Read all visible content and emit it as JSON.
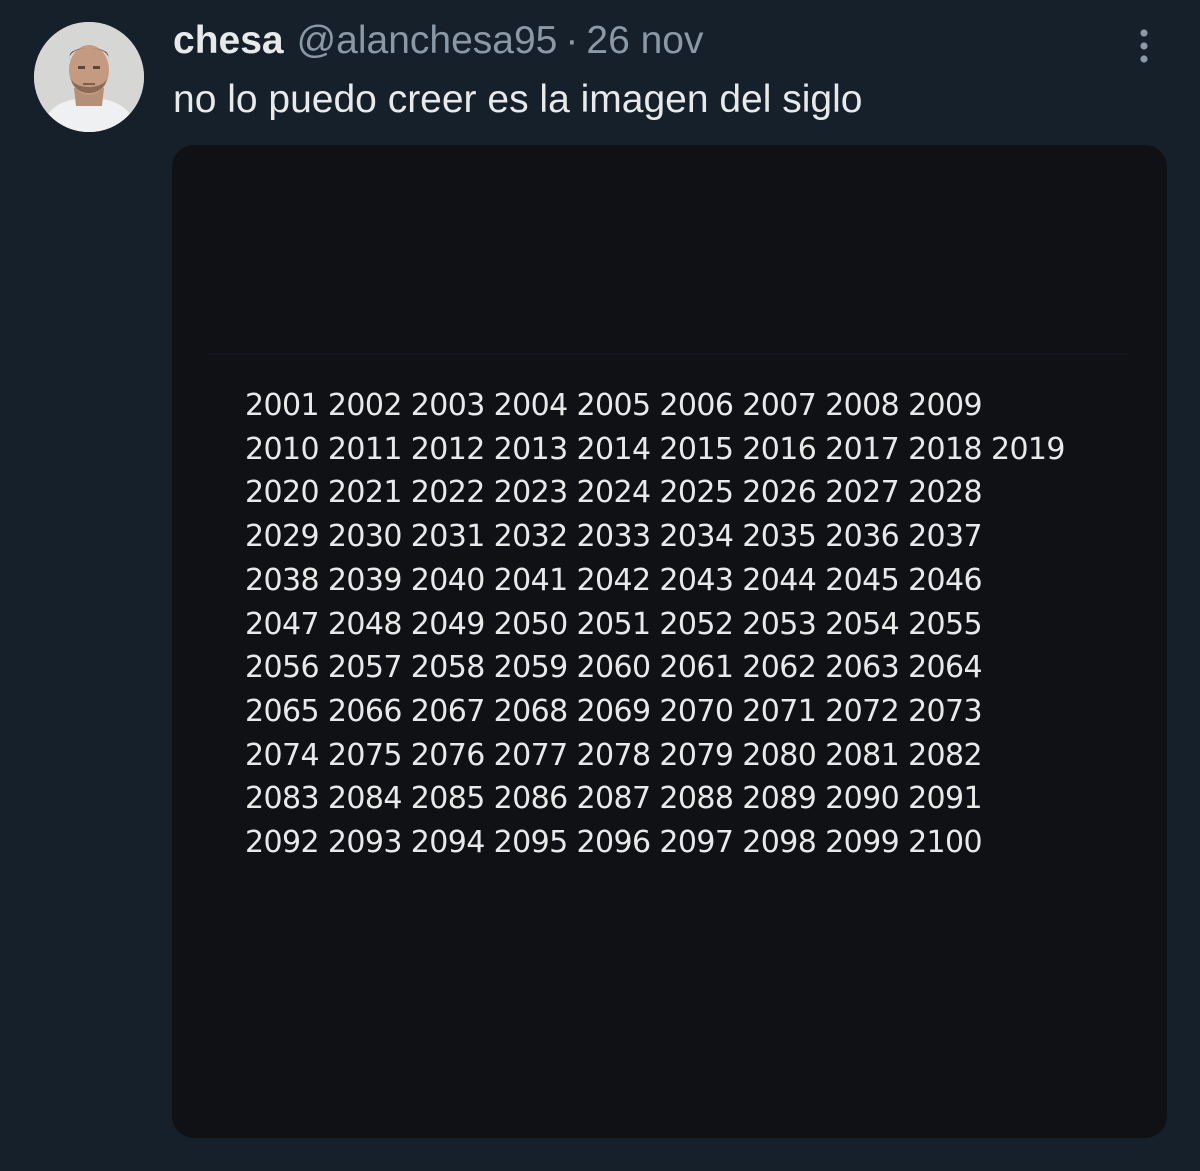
{
  "tweet": {
    "display_name": "chesa",
    "handle": "@alanchesa95",
    "separator": "·",
    "date": "26 nov",
    "text": "no lo puedo creer es la imagen del siglo",
    "more_icon": "vertical-ellipsis-icon",
    "avatar": "profile-photo"
  },
  "media": {
    "rows": [
      "2001 2002 2003 2004 2005 2006 2007 2008 2009",
      "2010 2011 2012 2013 2014 2015 2016 2017 2018 2019",
      "2020 2021 2022 2023 2024 2025 2026 2027 2028",
      "2029 2030 2031 2032 2033 2034 2035 2036 2037",
      "2038 2039 2040 2041 2042 2043 2044 2045 2046",
      "2047 2048 2049 2050 2051 2052 2053 2054 2055",
      "2056 2057 2058 2059 2060 2061 2062 2063 2064",
      "2065 2066 2067 2068 2069 2070 2071 2072 2073",
      "2074 2075 2076 2077 2078 2079 2080 2081 2082",
      "2083 2084 2085 2086 2087 2088 2089 2090 2091",
      "2092 2093 2094 2095 2096 2097 2098 2099 2100"
    ]
  },
  "colors": {
    "background": "#15202b",
    "media_background": "#101115",
    "primary_text": "#e7e9ea",
    "secondary_text": "#8b98a5"
  }
}
